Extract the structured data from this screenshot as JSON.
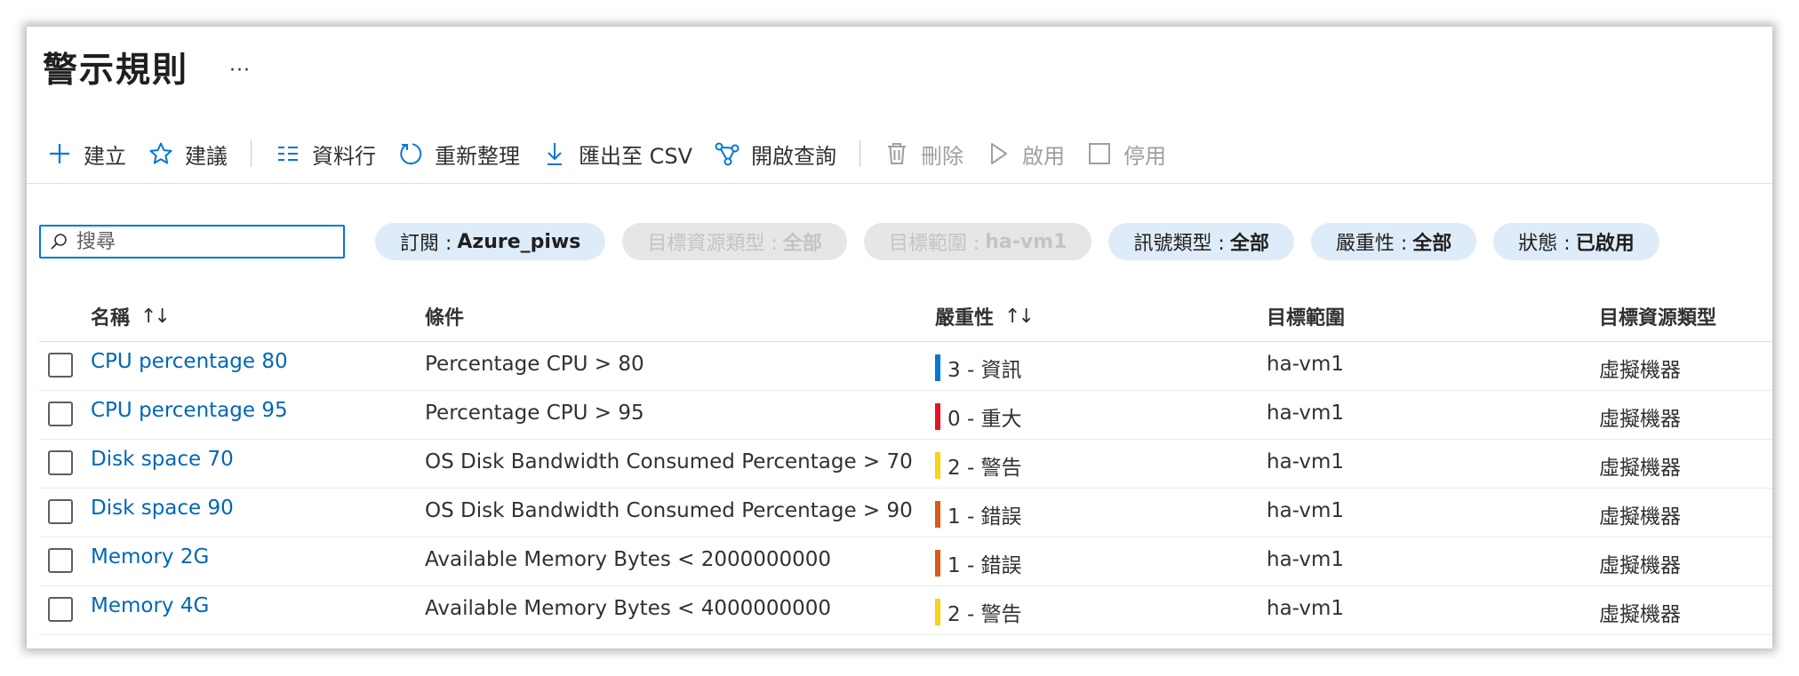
{
  "page": {
    "title": "警示規則",
    "more_label": "···"
  },
  "toolbar": {
    "create": "建立",
    "recommend": "建議",
    "columns": "資料行",
    "refresh": "重新整理",
    "export": "匯出至 CSV",
    "query": "開啟查詢",
    "delete": "刪除",
    "enable": "啟用",
    "disable": "停用"
  },
  "search": {
    "placeholder": "搜尋",
    "value": ""
  },
  "filters": {
    "subscription": {
      "key": "訂閱 :",
      "value": "Azure_piws"
    },
    "resource_type": {
      "key": "目標資源類型 :",
      "value": "全部"
    },
    "scope": {
      "key": "目標範圍 :",
      "value": "ha-vm1"
    },
    "signal_type": {
      "key": "訊號類型 :",
      "value": "全部"
    },
    "severity": {
      "key": "嚴重性 :",
      "value": "全部"
    },
    "status": {
      "key": "狀態 :",
      "value": "已啟用"
    }
  },
  "table": {
    "headers": {
      "name": "名稱",
      "condition": "條件",
      "severity": "嚴重性",
      "scope": "目標範圍",
      "resource_type": "目標資源類型",
      "sort_glyph": "↑↓"
    },
    "rows": [
      {
        "name": "CPU percentage 80",
        "condition": "Percentage CPU > 80",
        "severity": "3 - 資訊",
        "severity_color": "#0078d4",
        "scope": "ha-vm1",
        "resource_type": "虛擬機器"
      },
      {
        "name": "CPU percentage 95",
        "condition": "Percentage CPU > 95",
        "severity": "0 - 重大",
        "severity_color": "#e81123",
        "scope": "ha-vm1",
        "resource_type": "虛擬機器"
      },
      {
        "name": "Disk space 70",
        "condition": "OS Disk Bandwidth Consumed Percentage > 70",
        "severity": "2 - 警告",
        "severity_color": "#fcd116",
        "scope": "ha-vm1",
        "resource_type": "虛擬機器"
      },
      {
        "name": "Disk space 90",
        "condition": "OS Disk Bandwidth Consumed Percentage > 90",
        "severity": "1 - 錯誤",
        "severity_color": "#da5b13",
        "scope": "ha-vm1",
        "resource_type": "虛擬機器"
      },
      {
        "name": "Memory 2G",
        "condition": "Available Memory Bytes < 2000000000",
        "severity": "1 - 錯誤",
        "severity_color": "#da5b13",
        "scope": "ha-vm1",
        "resource_type": "虛擬機器"
      },
      {
        "name": "Memory 4G",
        "condition": "Available Memory Bytes < 4000000000",
        "severity": "2 - 警告",
        "severity_color": "#fcd116",
        "scope": "ha-vm1",
        "resource_type": "虛擬機器"
      }
    ]
  },
  "colors": {
    "accent": "#0078d4",
    "link": "#0067b8",
    "pill": "#deecf9",
    "pill_disabled": "#e6e6e6"
  },
  "icons": {
    "create": "plus-icon",
    "recommend": "star-icon",
    "columns": "columns-icon",
    "refresh": "refresh-icon",
    "export": "download-icon",
    "query": "share-nodes-icon",
    "delete": "trash-icon",
    "enable": "play-icon",
    "disable": "checkbox-icon",
    "search": "search-icon"
  }
}
